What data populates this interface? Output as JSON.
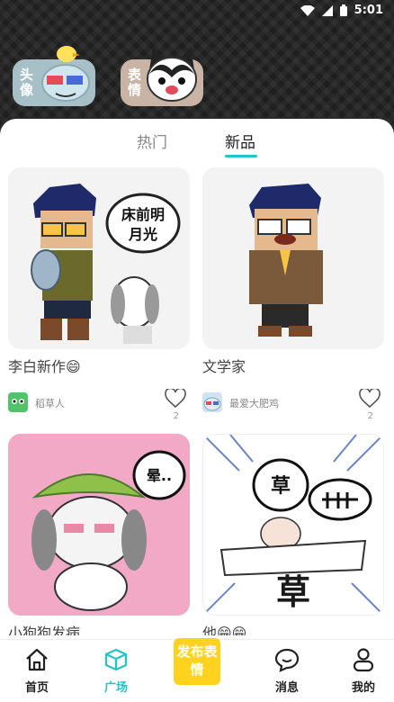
{
  "status_bar": {
    "time": "5:01"
  },
  "header": {
    "chips": [
      {
        "label": "头像"
      },
      {
        "label": "表情"
      }
    ]
  },
  "tabs": [
    {
      "label": "热门",
      "active": false
    },
    {
      "label": "新品",
      "active": true
    }
  ],
  "cards": [
    {
      "title": "李白新作😄",
      "user": "稻草人",
      "likes": "2",
      "bubble_text": "床前明月光"
    },
    {
      "title": "文学家",
      "user": "最爱大肥鸡",
      "likes": "2"
    },
    {
      "title": "小狗狗发病",
      "bubble_text": "晕.."
    },
    {
      "title": "他😁😁",
      "bubble_text": "草",
      "big_text": "草"
    }
  ],
  "bottom_nav": {
    "home": "首页",
    "square": "广场",
    "publish": "发布表情",
    "messages": "消息",
    "me": "我的"
  },
  "colors": {
    "accent": "#23c4c9",
    "publish": "#ffd21f"
  }
}
